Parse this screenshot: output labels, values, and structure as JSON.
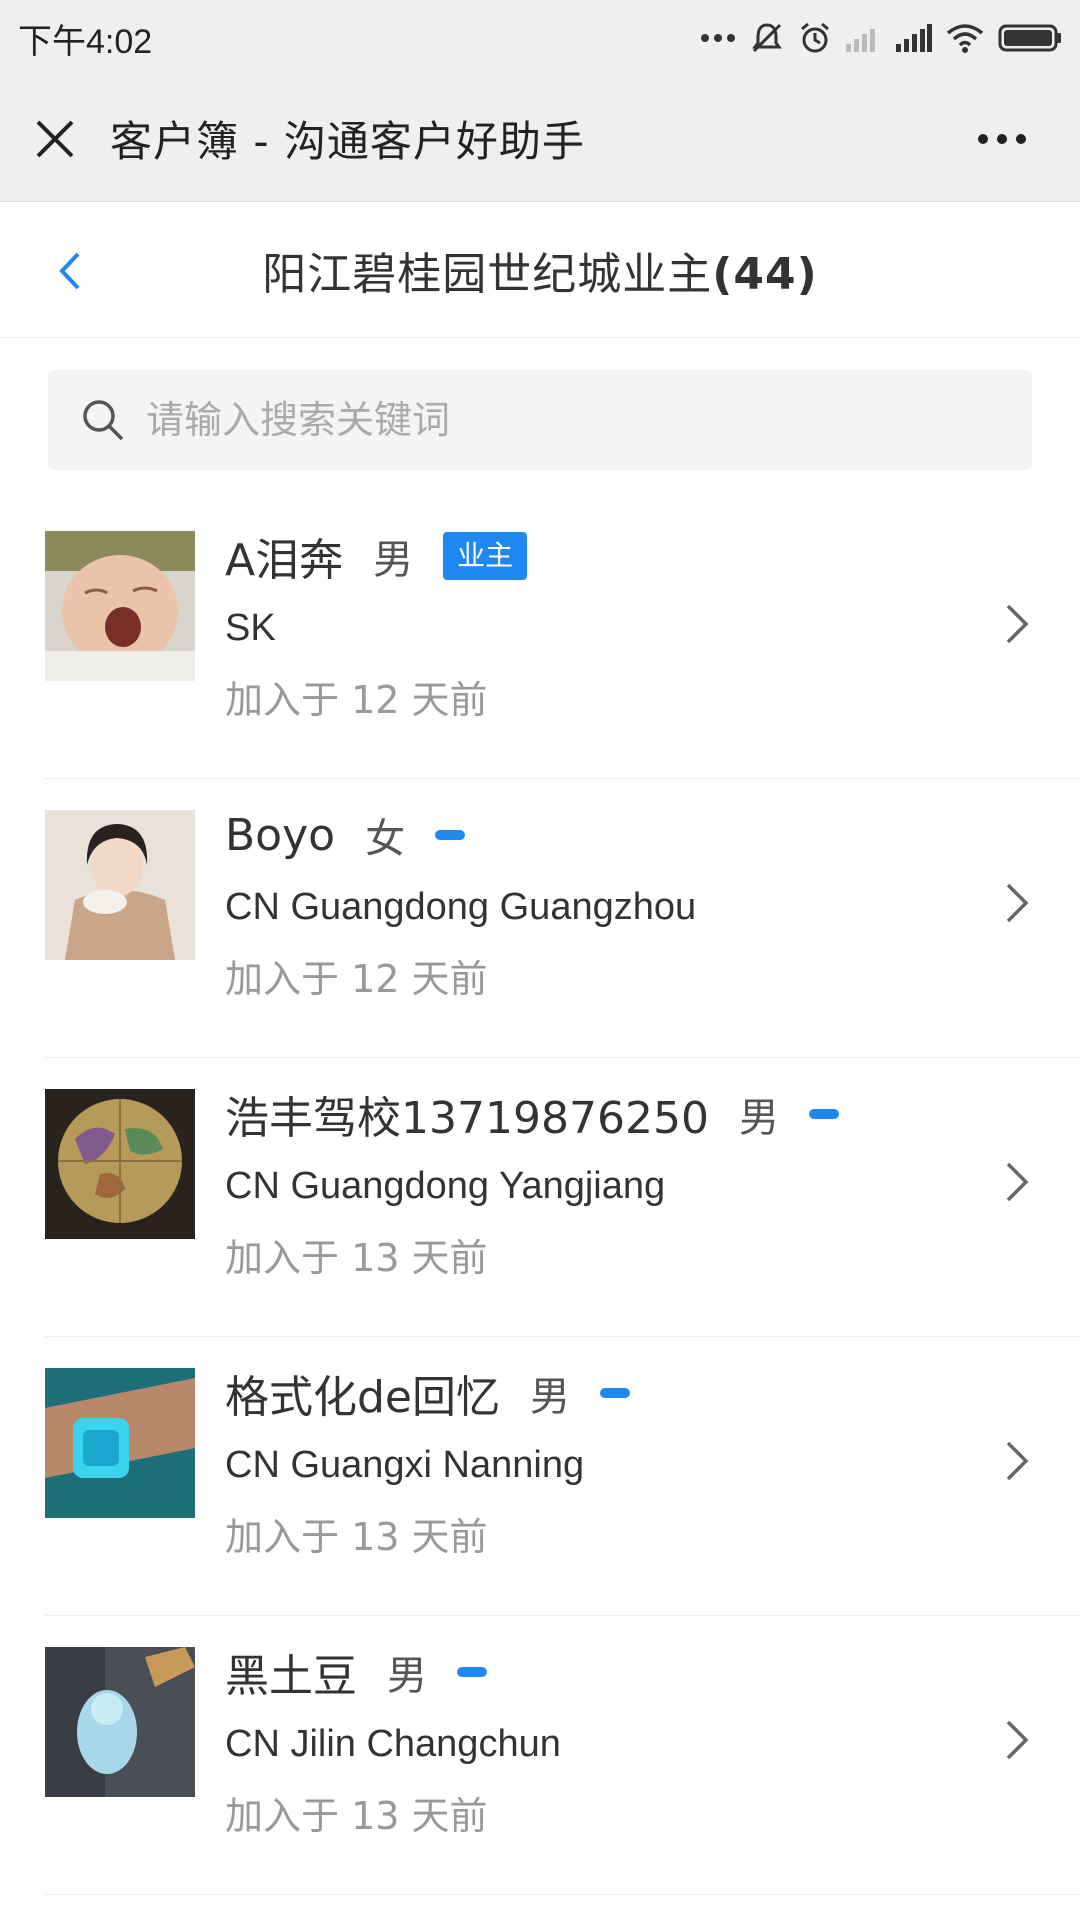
{
  "status_bar": {
    "time": "下午4:02"
  },
  "title_bar": {
    "title": "客户簿 - 沟通客户好助手"
  },
  "page_header": {
    "title": "阳江碧桂园世纪城业主",
    "count": "(44)"
  },
  "search": {
    "placeholder": "请输入搜索关键词"
  },
  "customers": [
    {
      "name": "A泪奔",
      "gender": "男",
      "tag": "业主",
      "location": "SK",
      "joined": "加入于 12 天前",
      "avatar": "baby-yawning"
    },
    {
      "name": "Boyo",
      "gender": "女",
      "tag": "",
      "location": "CN Guangdong Guangzhou",
      "joined": "加入于 12 天前",
      "avatar": "woman-portrait"
    },
    {
      "name": "浩丰驾校13719876250",
      "gender": "男",
      "tag": "",
      "location": "CN Guangdong Yangjiang",
      "joined": "加入于 13 天前",
      "avatar": "globe"
    },
    {
      "name": "格式化de回忆",
      "gender": "男",
      "tag": "",
      "location": "CN Guangxi Nanning",
      "joined": "加入于 13 天前",
      "avatar": "wrist-watch"
    },
    {
      "name": "黑土豆",
      "gender": "男",
      "tag": "",
      "location": "CN Jilin Changchun",
      "joined": "加入于 13 天前",
      "avatar": "jade-figure"
    }
  ],
  "colors": {
    "accent": "#1e88f0",
    "bar_bg": "#efefef"
  }
}
